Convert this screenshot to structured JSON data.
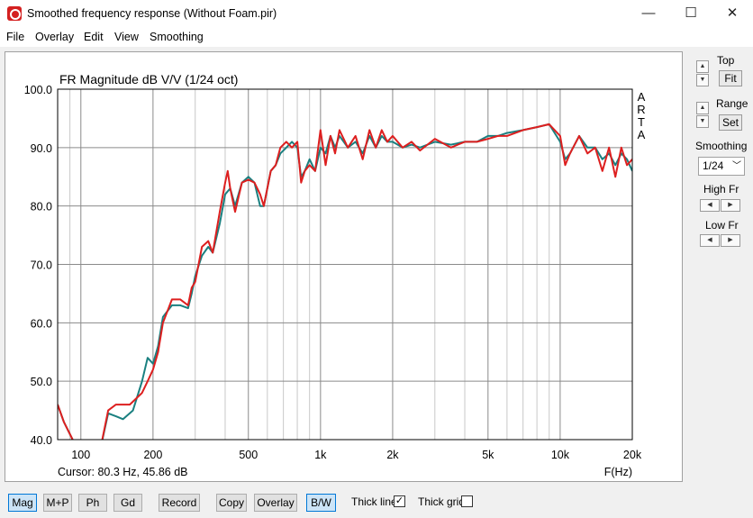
{
  "window": {
    "title": "Smoothed frequency response (Without Foam.pir)",
    "minimize": "—",
    "maximize": "☐",
    "close": "✕"
  },
  "menu": [
    "File",
    "Overlay",
    "Edit",
    "View",
    "Smoothing"
  ],
  "chart_data": {
    "type": "line",
    "title": "FR Magnitude dB V/V (1/24 oct)",
    "xlabel": "F(Hz)",
    "ylabel": "",
    "x_scale": "log",
    "xlim": [
      80,
      20000
    ],
    "ylim": [
      40,
      100
    ],
    "x_ticks": [
      {
        "v": 100,
        "label": "100"
      },
      {
        "v": 200,
        "label": "200"
      },
      {
        "v": 500,
        "label": "500"
      },
      {
        "v": 1000,
        "label": "1k"
      },
      {
        "v": 2000,
        "label": "2k"
      },
      {
        "v": 5000,
        "label": "5k"
      },
      {
        "v": 10000,
        "label": "10k"
      },
      {
        "v": 20000,
        "label": "20k"
      }
    ],
    "y_ticks": [
      {
        "v": 100,
        "label": "100.0"
      },
      {
        "v": 90,
        "label": "90.0"
      },
      {
        "v": 80,
        "label": "80.0"
      },
      {
        "v": 70,
        "label": "70.0"
      },
      {
        "v": 60,
        "label": "60.0"
      },
      {
        "v": 50,
        "label": "50.0"
      },
      {
        "v": 40,
        "label": "40.0"
      }
    ],
    "minor_x_gridlines": [
      90,
      300,
      400,
      600,
      700,
      800,
      900,
      3000,
      4000,
      6000,
      7000,
      8000,
      9000
    ],
    "side_label": [
      "A",
      "R",
      "T",
      "A"
    ],
    "cursor_text": "Cursor: 80.3 Hz, 45.86 dB",
    "grid": true,
    "series": [
      {
        "color": "#1a8080",
        "points": [
          [
            80,
            46
          ],
          [
            85,
            43
          ],
          [
            95,
            39
          ],
          [
            120,
            38
          ],
          [
            130,
            44.5
          ],
          [
            140,
            44
          ],
          [
            150,
            43.5
          ],
          [
            165,
            45
          ],
          [
            180,
            50
          ],
          [
            190,
            54
          ],
          [
            200,
            53
          ],
          [
            210,
            56
          ],
          [
            220,
            61
          ],
          [
            240,
            63
          ],
          [
            260,
            63
          ],
          [
            280,
            62.5
          ],
          [
            290,
            65
          ],
          [
            300,
            68
          ],
          [
            320,
            71.5
          ],
          [
            340,
            73
          ],
          [
            355,
            72
          ],
          [
            380,
            77
          ],
          [
            400,
            82
          ],
          [
            420,
            83
          ],
          [
            440,
            80
          ],
          [
            470,
            84
          ],
          [
            500,
            85
          ],
          [
            530,
            84
          ],
          [
            560,
            80
          ],
          [
            580,
            80
          ],
          [
            620,
            86
          ],
          [
            650,
            87
          ],
          [
            680,
            89
          ],
          [
            720,
            90
          ],
          [
            760,
            91
          ],
          [
            800,
            90
          ],
          [
            830,
            85
          ],
          [
            860,
            86
          ],
          [
            900,
            88
          ],
          [
            950,
            86
          ],
          [
            1000,
            90
          ],
          [
            1050,
            89
          ],
          [
            1100,
            92
          ],
          [
            1150,
            90
          ],
          [
            1200,
            92
          ],
          [
            1300,
            90
          ],
          [
            1400,
            91
          ],
          [
            1500,
            89
          ],
          [
            1600,
            92
          ],
          [
            1700,
            90
          ],
          [
            1800,
            92
          ],
          [
            1900,
            91
          ],
          [
            2000,
            91
          ],
          [
            2200,
            90
          ],
          [
            2400,
            90.5
          ],
          [
            2600,
            90
          ],
          [
            3000,
            91
          ],
          [
            3500,
            90.5
          ],
          [
            4000,
            91
          ],
          [
            4500,
            91
          ],
          [
            5000,
            92
          ],
          [
            5500,
            92
          ],
          [
            6000,
            92.5
          ],
          [
            7000,
            93
          ],
          [
            8000,
            93.5
          ],
          [
            9000,
            94
          ],
          [
            10000,
            91
          ],
          [
            10500,
            88
          ],
          [
            11000,
            89
          ],
          [
            12000,
            92
          ],
          [
            13000,
            90
          ],
          [
            14000,
            90
          ],
          [
            15000,
            88
          ],
          [
            16000,
            89
          ],
          [
            17000,
            87
          ],
          [
            18000,
            89
          ],
          [
            19000,
            88
          ],
          [
            20000,
            86
          ]
        ]
      },
      {
        "color": "#dd1f1f",
        "points": [
          [
            80,
            46
          ],
          [
            85,
            43
          ],
          [
            95,
            39
          ],
          [
            120,
            38
          ],
          [
            130,
            45
          ],
          [
            140,
            46
          ],
          [
            160,
            46
          ],
          [
            180,
            48
          ],
          [
            190,
            50
          ],
          [
            200,
            52
          ],
          [
            210,
            55
          ],
          [
            220,
            60
          ],
          [
            240,
            64
          ],
          [
            260,
            64
          ],
          [
            280,
            63
          ],
          [
            290,
            66
          ],
          [
            300,
            67
          ],
          [
            320,
            73
          ],
          [
            340,
            74
          ],
          [
            355,
            72
          ],
          [
            380,
            79
          ],
          [
            400,
            84
          ],
          [
            410,
            86
          ],
          [
            420,
            83
          ],
          [
            440,
            79
          ],
          [
            470,
            84
          ],
          [
            500,
            84.5
          ],
          [
            530,
            84
          ],
          [
            560,
            82
          ],
          [
            580,
            80
          ],
          [
            620,
            86
          ],
          [
            650,
            87
          ],
          [
            680,
            90
          ],
          [
            720,
            91
          ],
          [
            760,
            90
          ],
          [
            800,
            91
          ],
          [
            830,
            84
          ],
          [
            860,
            86
          ],
          [
            900,
            87
          ],
          [
            950,
            86
          ],
          [
            1000,
            93
          ],
          [
            1050,
            87
          ],
          [
            1100,
            92
          ],
          [
            1150,
            89
          ],
          [
            1200,
            93
          ],
          [
            1300,
            90
          ],
          [
            1400,
            92
          ],
          [
            1500,
            88
          ],
          [
            1600,
            93
          ],
          [
            1700,
            90
          ],
          [
            1800,
            93
          ],
          [
            1900,
            91
          ],
          [
            2000,
            92
          ],
          [
            2200,
            90
          ],
          [
            2400,
            91
          ],
          [
            2600,
            89.5
          ],
          [
            3000,
            91.5
          ],
          [
            3500,
            90
          ],
          [
            4000,
            91
          ],
          [
            4500,
            91
          ],
          [
            5000,
            91.5
          ],
          [
            5500,
            92
          ],
          [
            6000,
            92
          ],
          [
            7000,
            93
          ],
          [
            8000,
            93.5
          ],
          [
            9000,
            94
          ],
          [
            10000,
            92
          ],
          [
            10500,
            87
          ],
          [
            11000,
            89
          ],
          [
            12000,
            92
          ],
          [
            13000,
            89
          ],
          [
            14000,
            90
          ],
          [
            15000,
            86
          ],
          [
            16000,
            90
          ],
          [
            17000,
            85
          ],
          [
            18000,
            90
          ],
          [
            19000,
            87
          ],
          [
            20000,
            88
          ]
        ]
      }
    ]
  },
  "right_panel": {
    "top_label": "Top",
    "fit_label": "Fit",
    "range_label": "Range",
    "set_label": "Set",
    "smoothing_label": "Smoothing",
    "smoothing_value": "1/24",
    "high_fr_label": "High Fr",
    "low_fr_label": "Low Fr"
  },
  "bottom": {
    "buttons": [
      "Mag",
      "M+P",
      "Ph",
      "Gd",
      "Record",
      "Copy",
      "Overlay",
      "B/W"
    ],
    "thick_line_label": "Thick line",
    "thick_line_checked": true,
    "thick_grid_label": "Thick grid",
    "thick_grid_checked": false
  }
}
